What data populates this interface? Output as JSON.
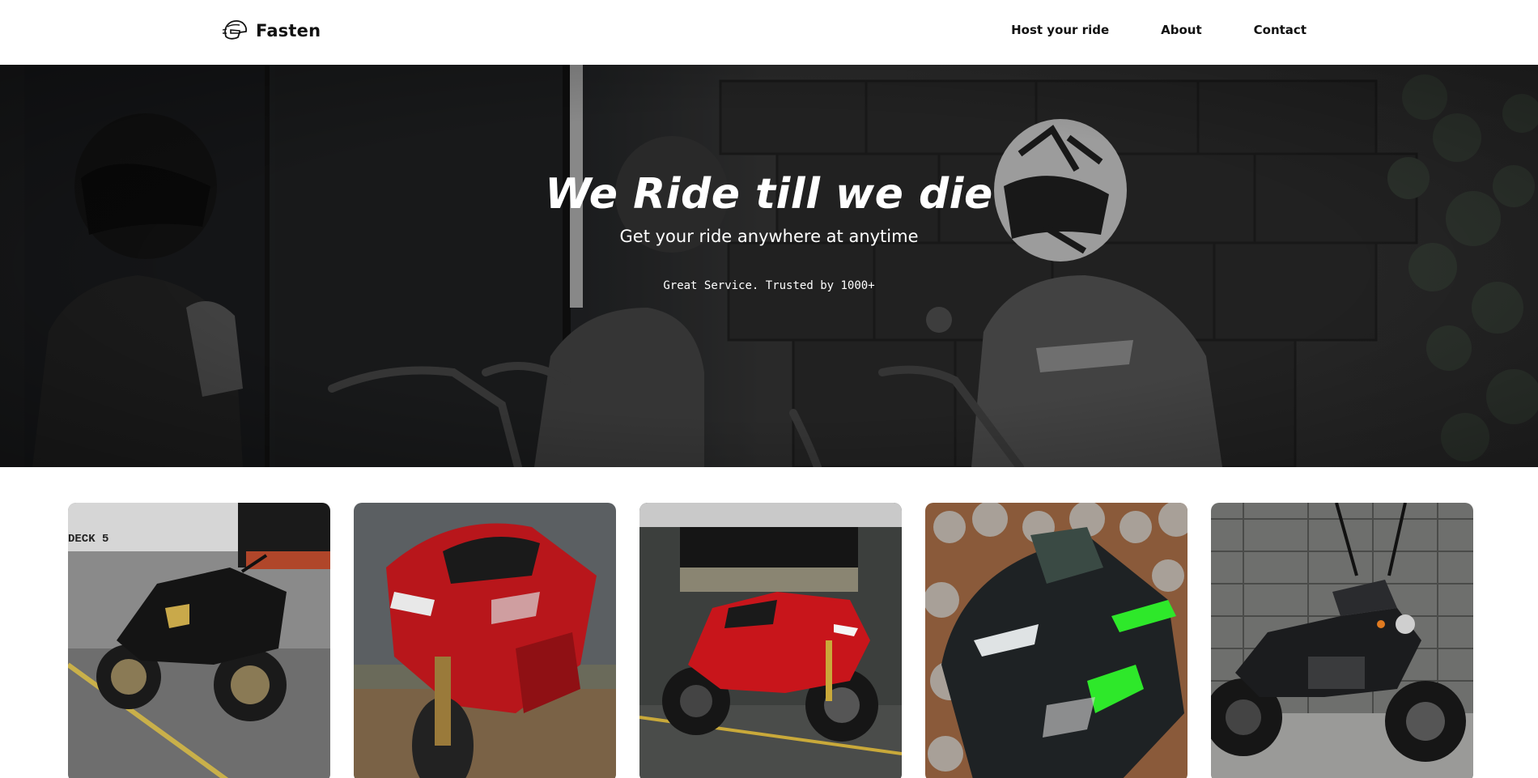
{
  "header": {
    "brand": "Fasten",
    "brand_icon": "helmet-icon",
    "nav": [
      "Host your ride",
      "About",
      "Contact"
    ]
  },
  "hero": {
    "title": "We Ride till we die",
    "subtitle": "Get your ride anywhere at anytime",
    "tagline": "Great Service. Trusted by 1000+"
  },
  "bikes": [
    {
      "icon": "black-sport-bike-image"
    },
    {
      "icon": "red-sport-bike-image"
    },
    {
      "icon": "red-ducati-bike-image"
    },
    {
      "icon": "green-black-kawasaki-image"
    },
    {
      "icon": "black-cruiser-bike-image"
    }
  ],
  "colors": {
    "accent_red": "#c8151b",
    "accent_green": "#2ee82a",
    "text": "#111111",
    "hero_overlay": "#2a2a2a"
  }
}
